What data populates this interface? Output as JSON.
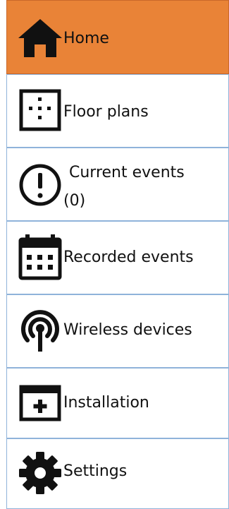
{
  "menu": {
    "items": [
      {
        "id": "home",
        "label": "Home",
        "icon": "home-icon",
        "active": true
      },
      {
        "id": "floor-plans",
        "label": "Floor plans",
        "icon": "floor-plan-icon",
        "active": false
      },
      {
        "id": "current-events",
        "label": "Current events",
        "count": "(0)",
        "icon": "alert-icon",
        "active": false
      },
      {
        "id": "recorded-events",
        "label": "Recorded events",
        "icon": "calendar-icon",
        "active": false
      },
      {
        "id": "wireless-devices",
        "label": "Wireless devices",
        "icon": "wireless-icon",
        "active": false
      },
      {
        "id": "installation",
        "label": "Installation",
        "icon": "installation-icon",
        "active": false
      },
      {
        "id": "settings",
        "label": "Settings",
        "icon": "gear-icon",
        "active": false
      }
    ]
  },
  "colors": {
    "active_background": "#e98337",
    "item_border": "#8fb3da",
    "text": "#111111"
  }
}
